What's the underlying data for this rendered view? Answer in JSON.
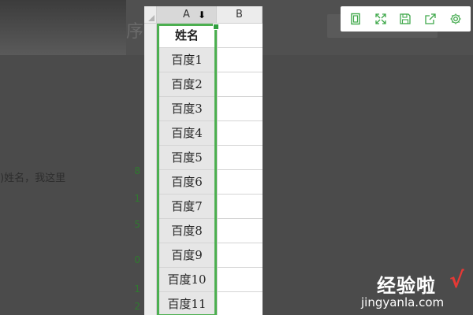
{
  "background": {
    "title_fragment": "序",
    "text_fragment": ")姓名，我这里",
    "row_numbers": [
      "8",
      "1",
      "5",
      "0",
      "1",
      "2"
    ]
  },
  "sheet": {
    "columns": [
      "A",
      "B"
    ],
    "select_arrow": "⬇",
    "header": "姓名",
    "rows": [
      "百度1",
      "百度2",
      "百度3",
      "百度4",
      "百度5",
      "百度6",
      "百度7",
      "百度8",
      "百度9",
      "百度10",
      "百度11"
    ]
  },
  "toolbar": {
    "buttons": [
      {
        "icon": "fit-page-icon"
      },
      {
        "icon": "fullscreen-icon"
      },
      {
        "icon": "save-icon"
      },
      {
        "icon": "share-icon"
      },
      {
        "icon": "settings-icon"
      }
    ]
  },
  "watermark": {
    "main": "经验啦",
    "check": "√",
    "sub": "jingyanla.com"
  },
  "colors": {
    "accent": "#4caf50",
    "overlay": "#4b4b4b"
  }
}
